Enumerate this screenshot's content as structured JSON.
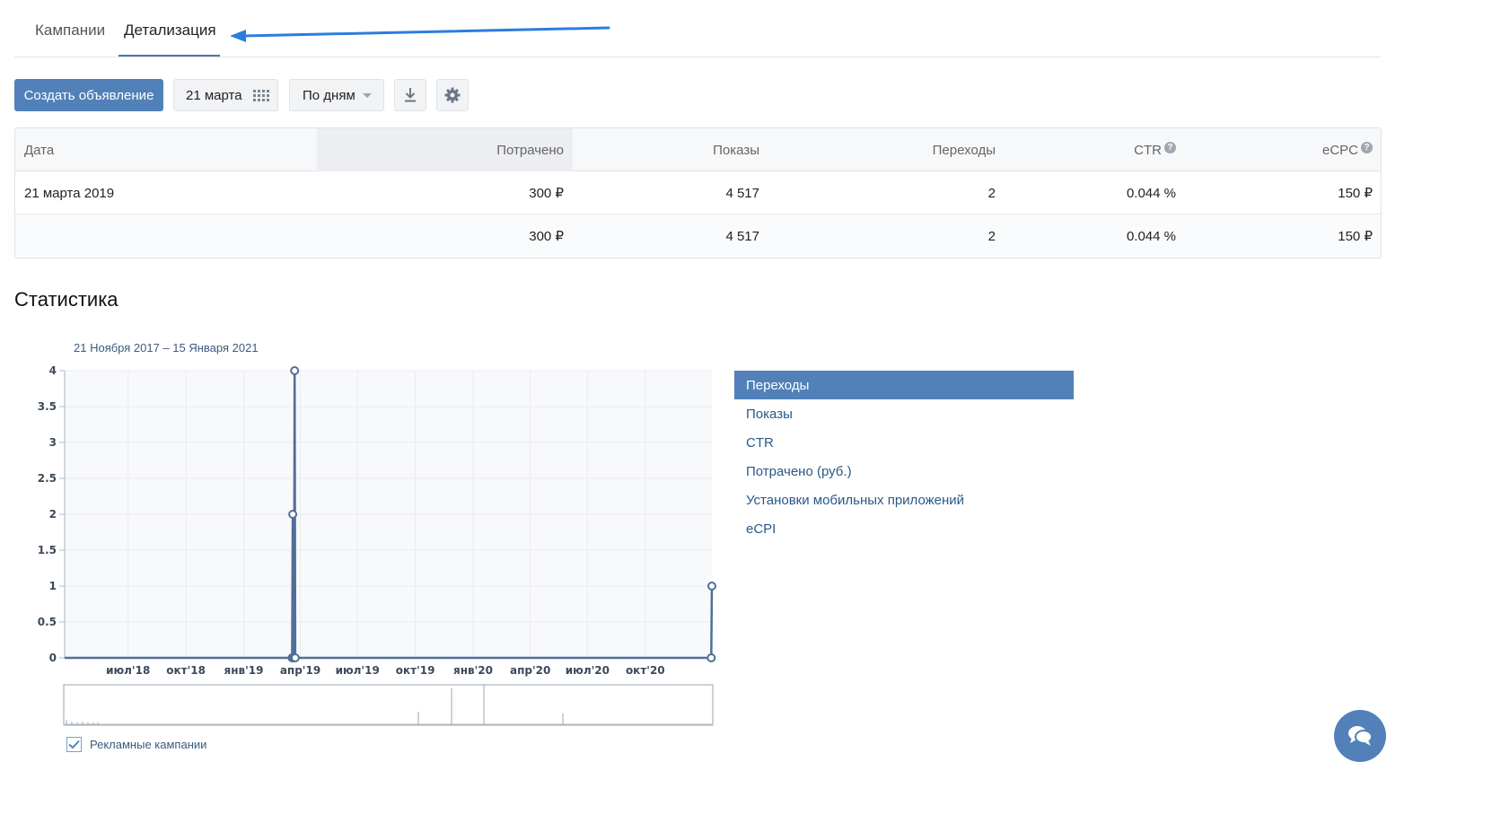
{
  "tabs": [
    {
      "label": "Кампании"
    },
    {
      "label": "Детализация"
    }
  ],
  "toolbar": {
    "create_label": "Создать объявление",
    "date_label": "21 марта",
    "period_label": "По дням"
  },
  "table": {
    "headers": {
      "date": "Дата",
      "spent": "Потрачено",
      "impressions": "Показы",
      "clicks": "Переходы",
      "ctr": "CTR",
      "ecpc": "eCPC"
    },
    "rows": [
      {
        "date": "21 марта 2019",
        "spent": "300 ₽",
        "impressions": "4 517",
        "clicks": "2",
        "ctr": "0.044 %",
        "ecpc": "150 ₽"
      },
      {
        "date": "",
        "spent": "300 ₽",
        "impressions": "4 517",
        "clicks": "2",
        "ctr": "0.044 %",
        "ecpc": "150 ₽"
      }
    ]
  },
  "stats": {
    "title": "Статистика",
    "range": "21 Ноября 2017 – 15 Января 2021",
    "metrics": [
      "Переходы",
      "Показы",
      "CTR",
      "Потрачено (руб.)",
      "Установки мобильных приложений",
      "eCPI"
    ],
    "active_metric": "Переходы",
    "checkbox_label": "Рекламные кампании",
    "checkbox_checked": true
  },
  "chart_data": {
    "type": "line",
    "title": "",
    "xlabel": "",
    "ylabel": "",
    "ylim": [
      0,
      4
    ],
    "y_ticks": [
      "0",
      "0.5",
      "1",
      "1.5",
      "2",
      "2.5",
      "3",
      "3.5",
      "4"
    ],
    "x_ticks": [
      "июл'18",
      "окт'18",
      "янв'19",
      "апр'19",
      "июл'19",
      "окт'19",
      "янв'20",
      "апр'20",
      "июл'20",
      "окт'20"
    ],
    "x_tick_dates": [
      "2018-07-01",
      "2018-10-01",
      "2019-01-01",
      "2019-04-01",
      "2019-07-01",
      "2019-10-01",
      "2020-01-01",
      "2020-04-01",
      "2020-07-01",
      "2020-10-01"
    ],
    "x_range": [
      "2018-03-22",
      "2021-01-15"
    ],
    "grid": true,
    "series": [
      {
        "points": [
          {
            "x": "2019-03-19",
            "y": 0
          },
          {
            "x": "2019-03-20",
            "y": 2
          },
          {
            "x": "2019-03-21",
            "y": 0
          },
          {
            "x": "2019-03-22",
            "y": 0
          },
          {
            "x": "2019-03-23",
            "y": 4
          },
          {
            "x": "2019-03-24",
            "y": 0
          },
          {
            "x": "2021-01-14",
            "y": 0
          },
          {
            "x": "2021-01-15",
            "y": 1
          }
        ]
      }
    ],
    "color": "#4f6f99"
  }
}
